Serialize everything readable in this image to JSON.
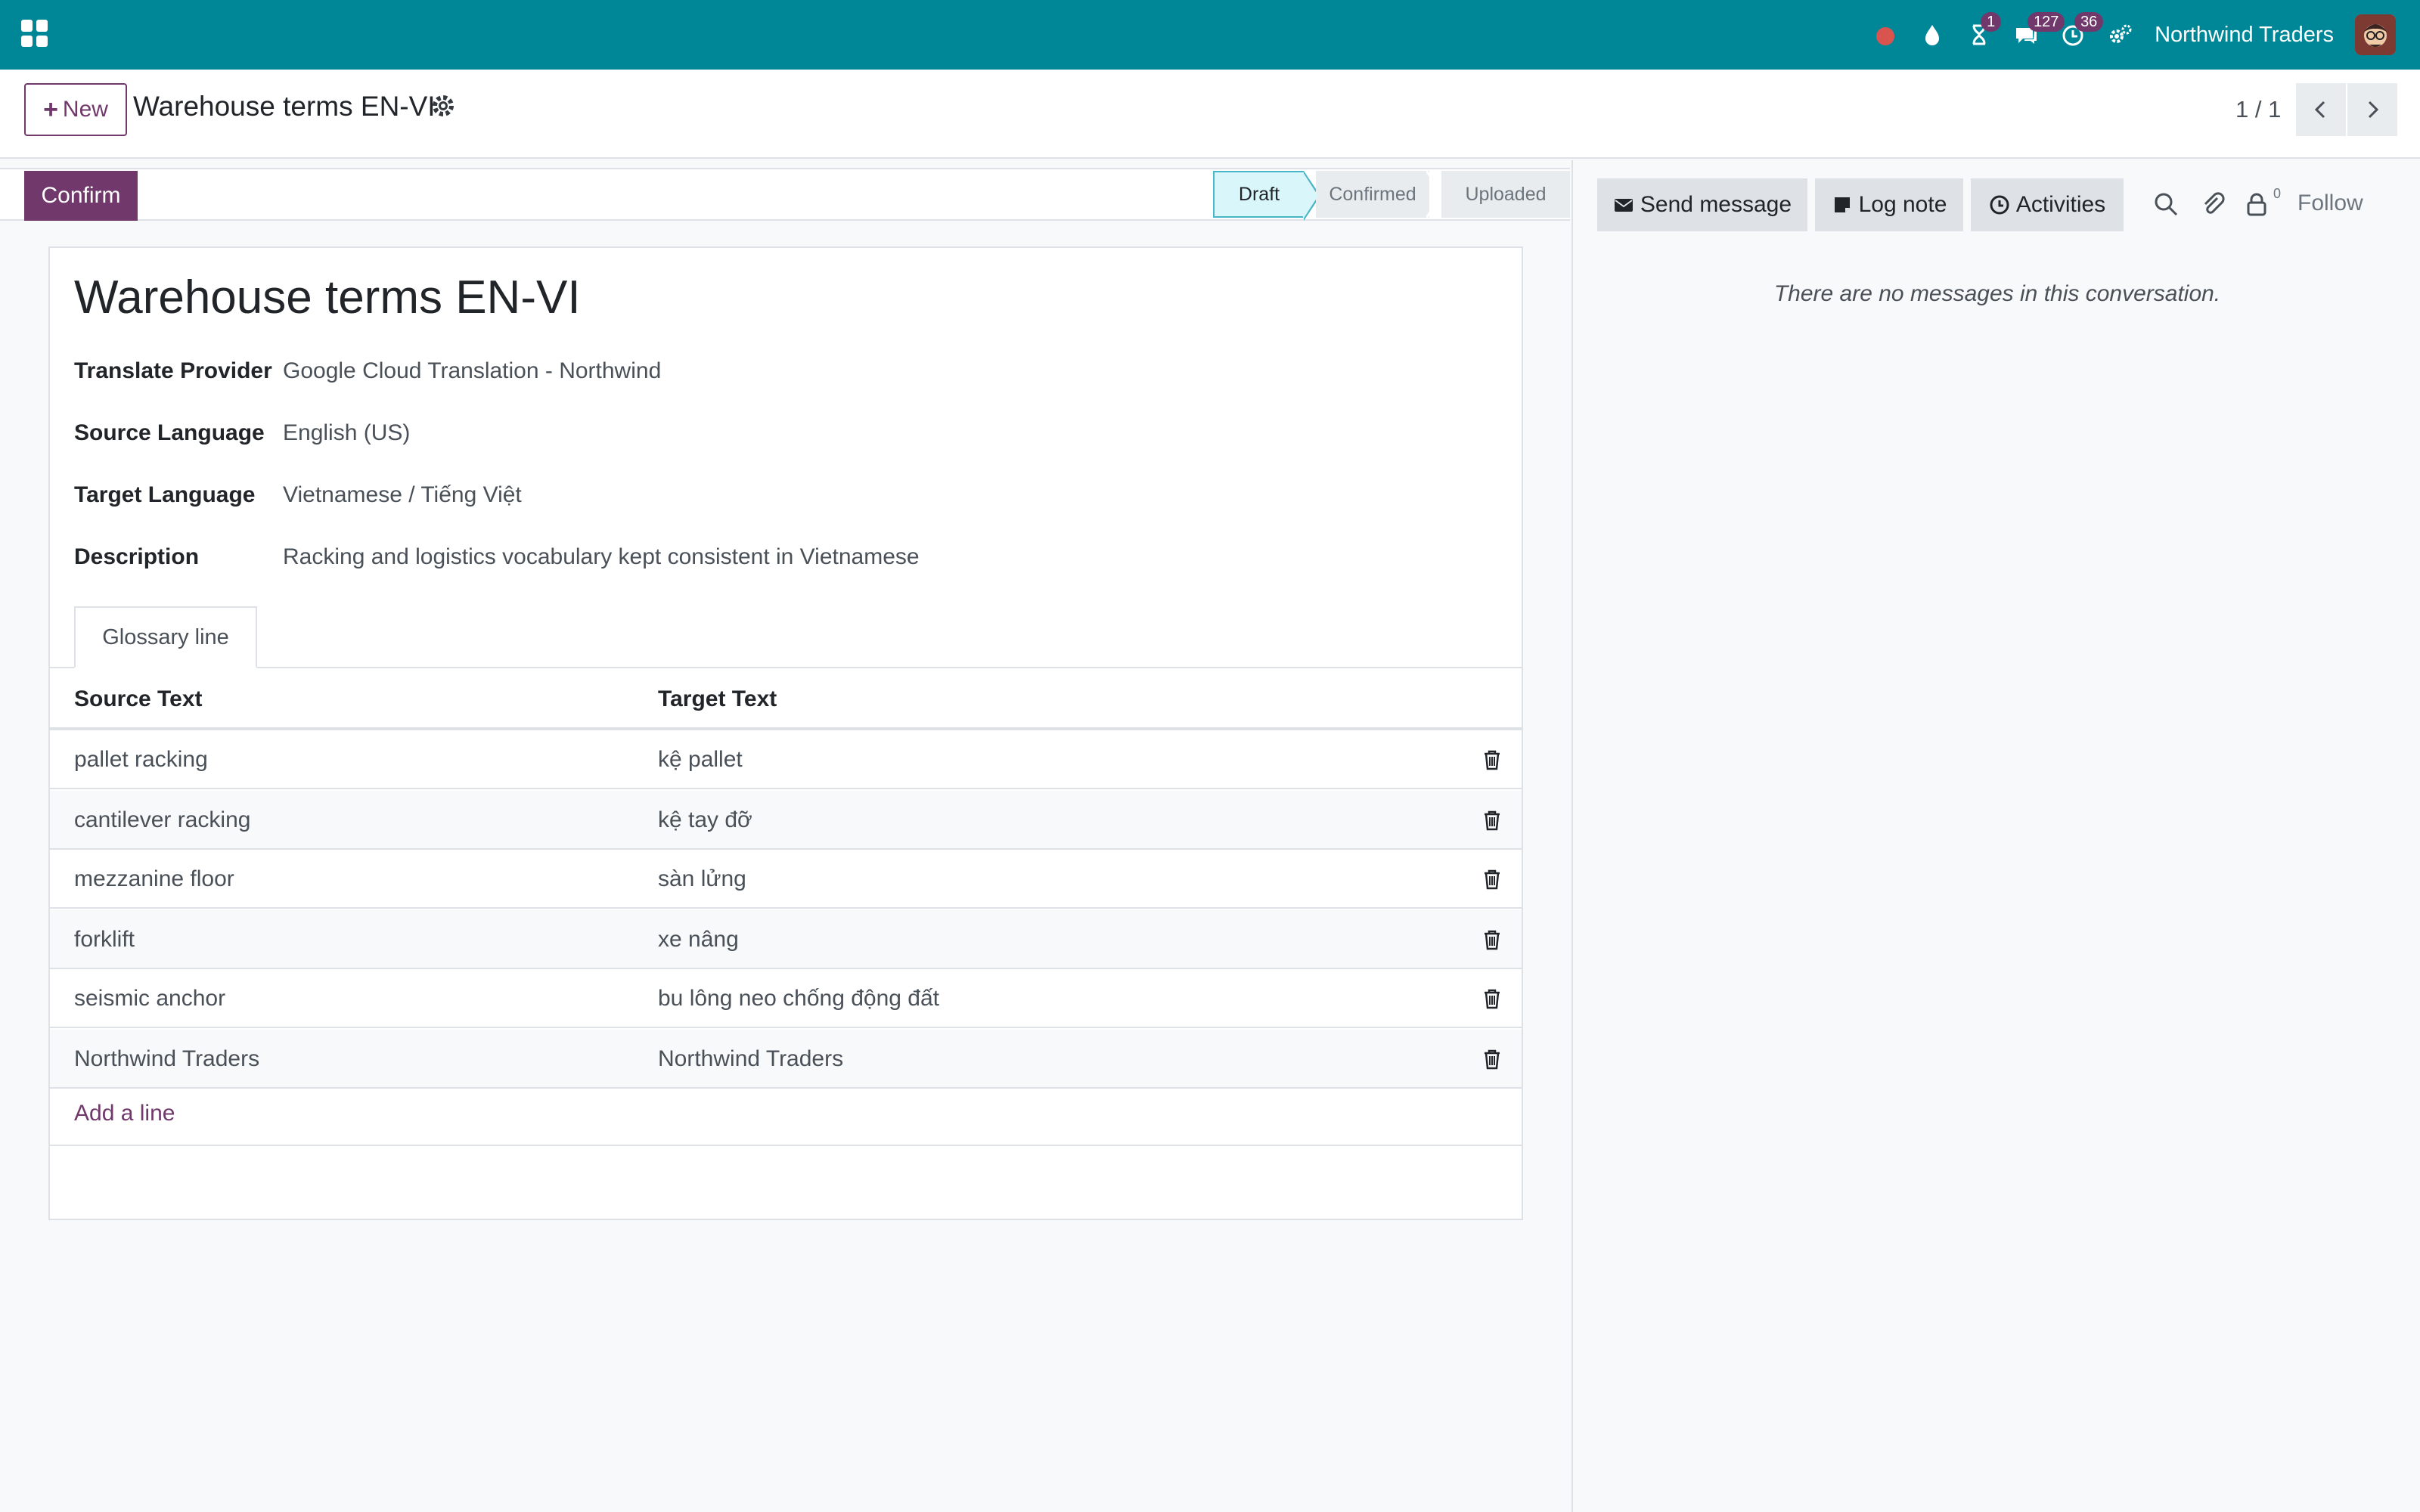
{
  "navbar": {
    "company": "Northwind Traders",
    "badges": {
      "activity": "1",
      "messages": "127",
      "clock": "36"
    },
    "colors": {
      "bar": "#008797",
      "badge": "#71396b"
    }
  },
  "control": {
    "new_label": "New",
    "breadcrumb": "Warehouse terms EN-VI",
    "pager": "1 / 1"
  },
  "status": {
    "confirm_label": "Confirm",
    "stages": [
      "Draft",
      "Confirmed",
      "Uploaded"
    ],
    "current": "Draft"
  },
  "record": {
    "title": "Warehouse terms EN-VI",
    "fields": [
      {
        "label": "Translate Provider",
        "value": "Google Cloud Translation - Northwind"
      },
      {
        "label": "Source Language",
        "value": "English (US)"
      },
      {
        "label": "Target Language",
        "value": "Vietnamese / Tiếng Việt"
      },
      {
        "label": "Description",
        "value": "Racking and logistics vocabulary kept consistent in Vietnamese"
      }
    ],
    "tab_label": "Glossary line",
    "columns": [
      "Source Text",
      "Target Text"
    ],
    "lines": [
      {
        "source": "pallet racking",
        "target": "kệ pallet"
      },
      {
        "source": "cantilever racking",
        "target": "kệ tay đỡ"
      },
      {
        "source": "mezzanine floor",
        "target": "sàn lửng"
      },
      {
        "source": "forklift",
        "target": "xe nâng"
      },
      {
        "source": "seismic anchor",
        "target": "bu lông neo chống động đất"
      },
      {
        "source": "Northwind Traders",
        "target": "Northwind Traders"
      }
    ],
    "add_line": "Add a line"
  },
  "chatter": {
    "send_message": "Send message",
    "log_note": "Log note",
    "activities": "Activities",
    "follower_count": "0",
    "follow": "Follow",
    "empty": "There are no messages in this conversation."
  }
}
